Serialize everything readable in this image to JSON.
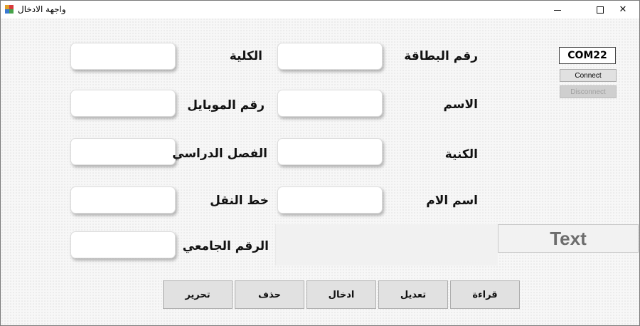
{
  "window": {
    "title": "واجهة الادخال",
    "controls": {
      "minimize": "—",
      "maximize": "☐",
      "close": "✕"
    }
  },
  "serial": {
    "port": "COM22",
    "connect_label": "Connect",
    "disconnect_label": "Disconnect"
  },
  "form": {
    "right_column": [
      {
        "label": "رقم البطاقة",
        "value": ""
      },
      {
        "label": "الاسم",
        "value": ""
      },
      {
        "label": "الكنية",
        "value": ""
      },
      {
        "label": "اسم الام",
        "value": ""
      }
    ],
    "left_column": [
      {
        "label": "الكلية",
        "value": ""
      },
      {
        "label": "رقم الموبايل",
        "value": ""
      },
      {
        "label": "الفصل الدراسي",
        "value": ""
      },
      {
        "label": "خط النقل",
        "value": ""
      },
      {
        "label": "الرقم الجامعي",
        "value": ""
      }
    ]
  },
  "display": {
    "text": "Text"
  },
  "actions": {
    "read": "قراءة",
    "edit": "تعديل",
    "insert": "ادخال",
    "delete": "حذف",
    "release": "تحرير"
  },
  "icons": {
    "app_icon": "app-icon",
    "minimize": "minimize-icon",
    "maximize": "maximize-icon",
    "close": "close-icon"
  }
}
